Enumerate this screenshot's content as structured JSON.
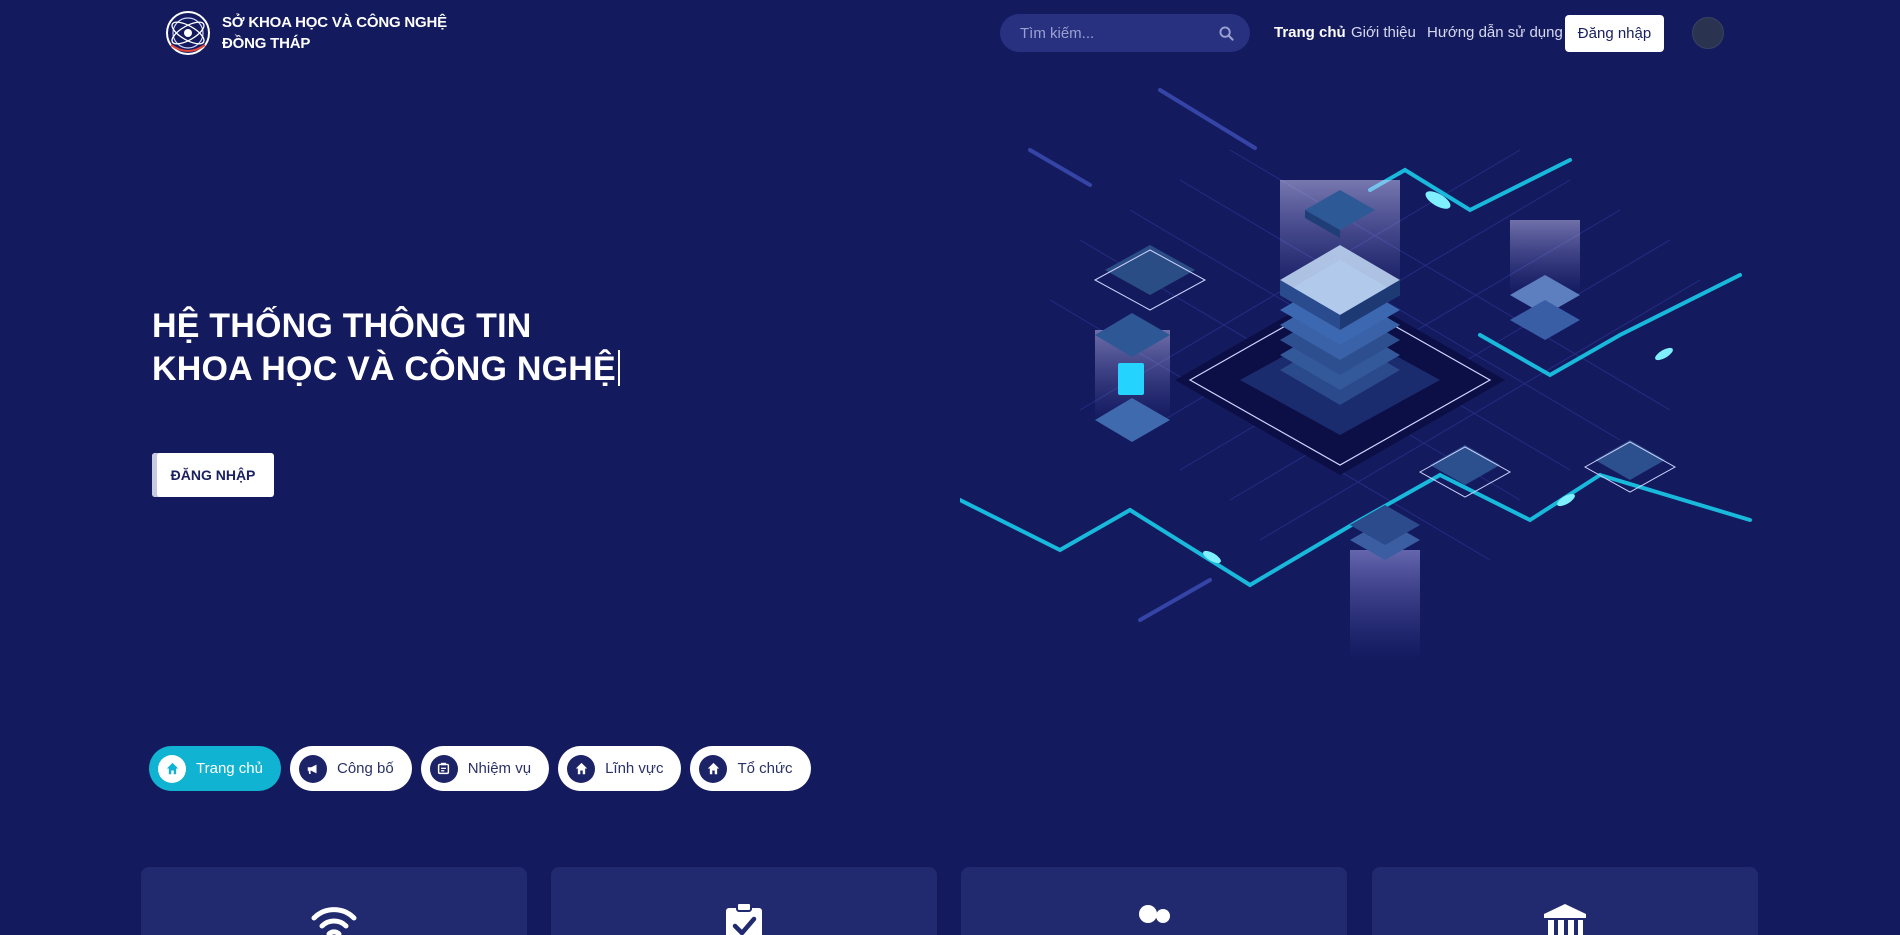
{
  "header": {
    "brand_line1": "SỞ KHOA HỌC VÀ CÔNG NGHỆ",
    "brand_line2": "ĐỒNG THÁP",
    "search_placeholder": "Tìm kiếm...",
    "nav": [
      {
        "label": "Trang chủ",
        "active": true
      },
      {
        "label": "Giới thiệu",
        "active": false
      },
      {
        "label": "Hướng dẫn sử dụng",
        "active": false
      }
    ],
    "login_label": "Đăng nhập"
  },
  "hero": {
    "title_line1": "HỆ THỐNG THÔNG TIN",
    "title_line2": "KHOA HỌC VÀ CÔNG NGHỆ",
    "button_label": "ĐĂNG NHẬP"
  },
  "tabs": [
    {
      "label": "Trang chủ",
      "icon": "home-icon",
      "active": true
    },
    {
      "label": "Công bố",
      "icon": "megaphone-icon",
      "active": false
    },
    {
      "label": "Nhiệm vụ",
      "icon": "task-icon",
      "active": false
    },
    {
      "label": "Lĩnh vực",
      "icon": "home-icon",
      "active": false
    },
    {
      "label": "Tổ chức",
      "icon": "home-icon",
      "active": false
    }
  ],
  "cards": [
    {
      "icon": "wifi-icon"
    },
    {
      "icon": "clipboard-check-icon"
    },
    {
      "icon": "users-icon"
    },
    {
      "icon": "institution-icon"
    }
  ],
  "colors": {
    "background": "#141a5e",
    "accent": "#10b3d1",
    "card": "#212a6e"
  }
}
